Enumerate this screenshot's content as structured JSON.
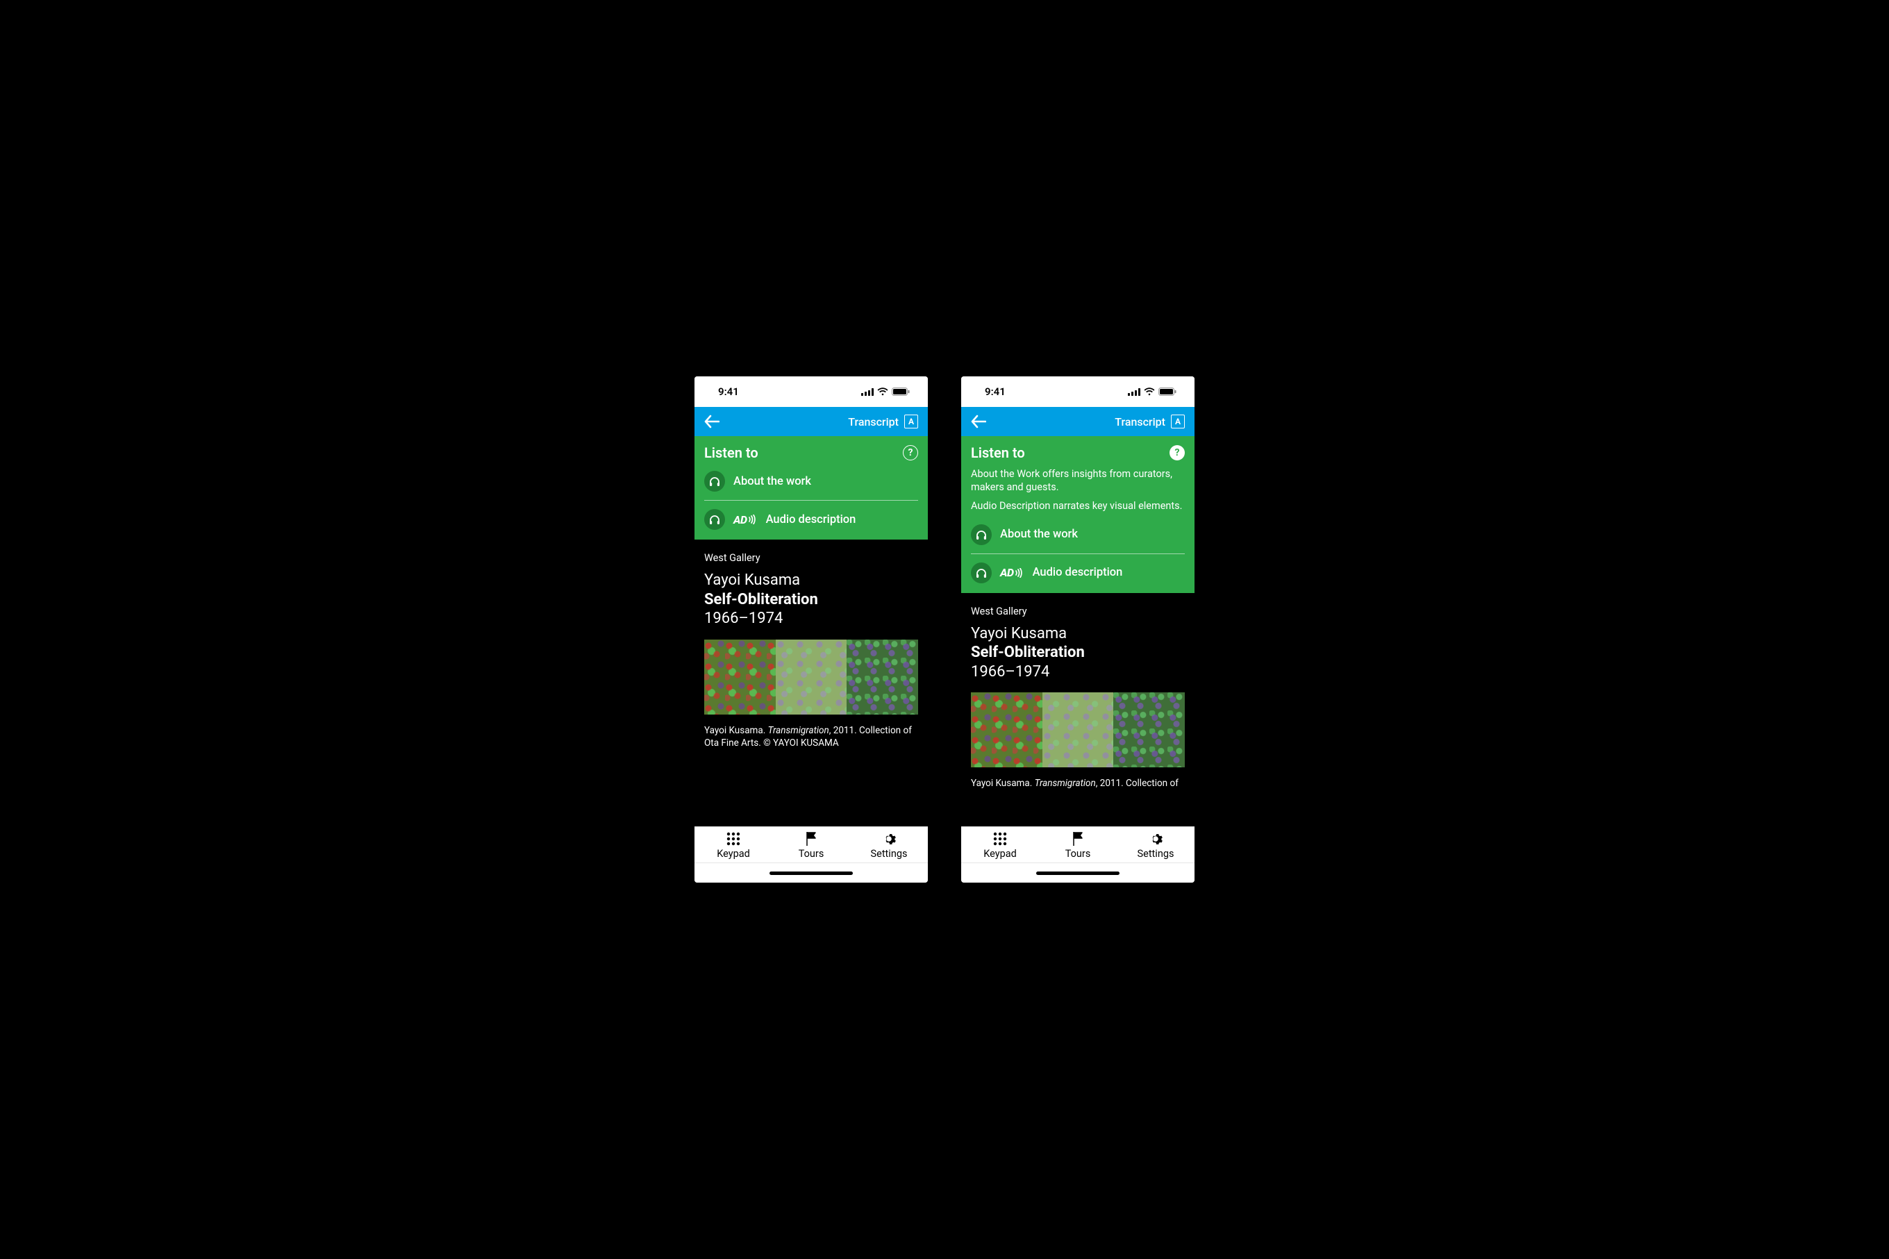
{
  "status": {
    "time": "9:41"
  },
  "header": {
    "transcript_label": "Transcript",
    "font_button": "A"
  },
  "listen": {
    "title": "Listen to",
    "help_glyph": "?",
    "items": {
      "about": "About the work",
      "audio_desc": "Audio description",
      "ad_badge": "AD"
    },
    "help_texts": {
      "about": "About the Work offers insights from curators, makers and guests.",
      "audio_desc": "Audio Description narrates key visual elements."
    }
  },
  "artwork": {
    "gallery": "West Gallery",
    "artist": "Yayoi Kusama",
    "title": "Self-Obliteration",
    "years": "1966–1974",
    "caption_prefix": "Yayoi Kusama. ",
    "caption_title": "Transmigration",
    "caption_suffix": ", 2011. Collection of Ota Fine Arts. © YAYOI KUSAMA",
    "caption_clip_prefix": "Yayoi Kusama. ",
    "caption_clip_title": "Transmigration",
    "caption_clip_suffix": ", 2011. Collection of"
  },
  "tabs": {
    "keypad": "Keypad",
    "tours": "Tours",
    "settings": "Settings"
  }
}
